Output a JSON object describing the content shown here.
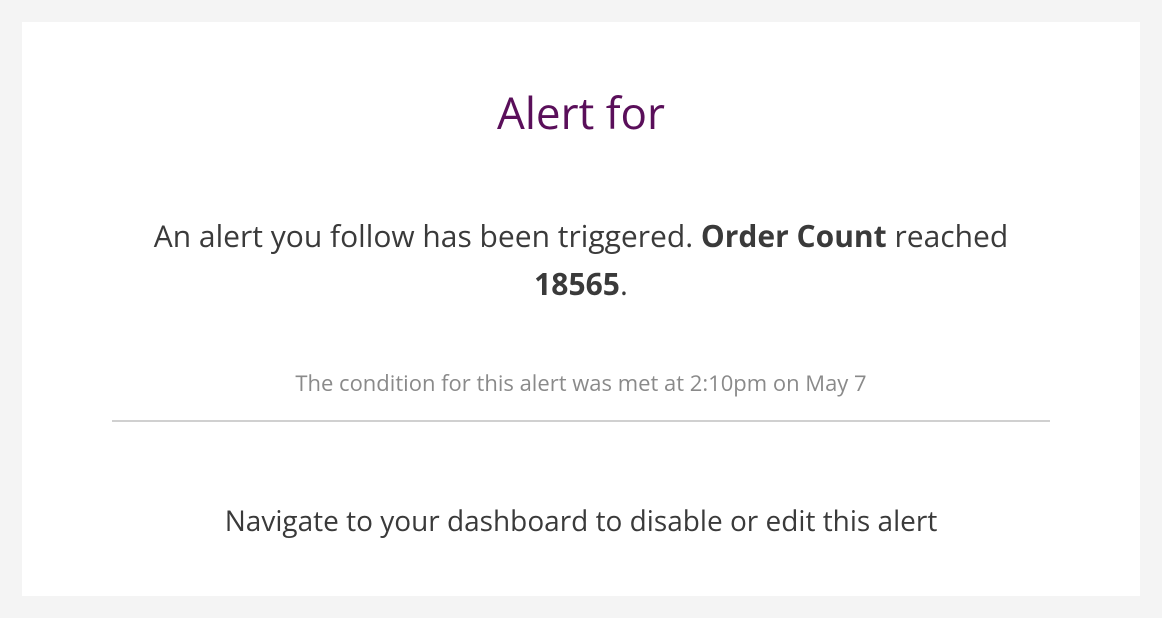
{
  "title": "Alert for",
  "message": {
    "prefix": "An alert you follow has been triggered. ",
    "metric": "Order Count",
    "between": " reached ",
    "value": "18565",
    "suffix": "."
  },
  "condition_text": "The condition for this alert was met at 2:10pm on May 7",
  "footer_text": "Navigate to your dashboard to disable or edit this alert"
}
